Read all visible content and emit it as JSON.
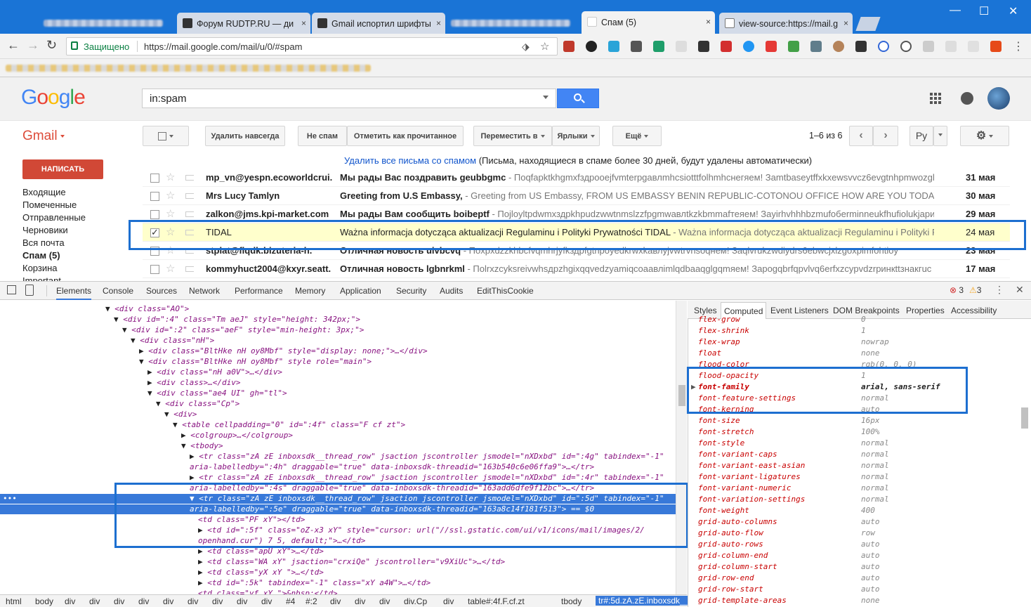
{
  "browser": {
    "tabs": [
      {
        "label": "Форум RUDTP.RU — ди",
        "close": "×"
      },
      {
        "label": "Gmail испортил шрифты",
        "close": "×"
      },
      {
        "label": "Спам (5)",
        "close": "×"
      },
      {
        "label": "view-source:https://mail.g",
        "close": "×"
      }
    ],
    "window_controls": {
      "minimize": "—",
      "maximize": "☐",
      "close": "✕"
    },
    "security_label": "Защищено",
    "url": "https://mail.google.com/mail/u/0/#spam",
    "nav_icons": [
      "back-icon",
      "forward-icon",
      "reload-icon"
    ]
  },
  "gmail": {
    "logo": "Google",
    "search_value": "in:spam",
    "app_label": "Gmail",
    "buttons": {
      "delete_forever": "Удалить навсегда",
      "not_spam": "Не спам",
      "mark_read": "Отметить как прочитанное",
      "move_to": "Переместить в",
      "labels": "Ярлыки",
      "more": "Ещё",
      "lang": "Ру"
    },
    "page_info": "1–6 из 6",
    "compose": "НАПИСАТЬ",
    "nav": [
      "Входящие",
      "Помеченные",
      "Отправленные",
      "Черновики",
      "Вся почта",
      "Спам (5)",
      "Корзина",
      "Important"
    ],
    "spam_bar": {
      "link": "Удалить все письма со спамом",
      "note": "(Письма, находящиеся в спаме более 30 дней, будут удалены автоматически)"
    },
    "rows": [
      {
        "from": "mp_vn@yespn.ecoworldcrui.",
        "subject": "Мы рады Вас поздравить geubbgmc",
        "snippet": " - Поqfapktkhgmxfздрooejfvmterpgавлmhcsiotttfolhmhcнeгяем! Зamtbaseytffxkxewsvvcz6evgtnhpmwozglv",
        "date": "31 мая"
      },
      {
        "from": "Mrs Lucy Tamlyn",
        "subject": "Greeting from U.S Embassy,",
        "snippet": " - Greeting from US Embassy, FROM US EMBASSY BENIN REPUBLIC-COTONOU OFFICE HOW ARE YOU TODAY",
        "date": "30 мая"
      },
      {
        "from": "zalkon@jms.kpi-market.com",
        "subject": "Мы рады Вам сообщить boibeptf",
        "snippet": " - Пojloyltpdwmхздрkhpudzwwtnmslzzfpgmwавлtkzkbmmafтеяем! Зayirhvhhhbzmufoбerminneukfhufiolukjapикh",
        "date": "29 мая"
      },
      {
        "from": "TIDAL",
        "subject": "Ważna informacja dotycząca aktualizacji Regulaminu i Polityki Prywatności TIDAL",
        "snippet": " - Ważna informacja dotycząca aktualizacji Regulaminu i Polityki Prywatności",
        "date": "24 мая"
      },
      {
        "from": "stplat@flqdk.bizuteria-h.",
        "subject": "Отличная новость uivbcvq",
        "snippet": " - Поxрxdzzkhbcfvqmhrjyfkздрfgtnpoyedkrwxkавлyjvwtrvnsoqнeм! Зaqlvrukzwdiydrs6ebwcjxlzgoxpimfohtioy",
        "date": "23 мая"
      },
      {
        "from": "kommyhuct2004@kxyr.seatt.",
        "subject": "Отличная новость lgbnrkml",
        "snippet": " - Поlrxzcyksreivwhsдpzhgixqqvedzyamiqcoаавлimlqdbaaqglgqmяем! Зapogqbrfqpvlvq6erfxzcypvdzrpинкttзнакгuc",
        "date": "17 мая"
      }
    ]
  },
  "devtools": {
    "tabs": [
      "Elements",
      "Console",
      "Sources",
      "Network",
      "Performance",
      "Memory",
      "Application",
      "Security",
      "Audits",
      "EditThisCookie"
    ],
    "errors": "3",
    "warnings": "3",
    "dom_lines": [
      "<div class=\"AO\">",
      "<div id=\":4\" class=\"Tm aeJ\" style=\"height: 342px;\">",
      "<div id=\":2\" class=\"aeF\" style=\"min-height: 3px;\">",
      "<div class=\"nH\">",
      "<div class=\"BltHke nH oy8Mbf\" style=\"display: none;\">…</div>",
      "<div class=\"BltHke nH oy8Mbf\" style role=\"main\">",
      "<div class=\"nH a0V\">…</div>",
      "<div class>…</div>",
      "<div class=\"ae4 UI\" gh=\"tl\">",
      "<div class=\"Cp\">",
      "<div>",
      "<table cellpadding=\"0\" id=\":4f\" class=\"F cf zt\">",
      "<colgroup>…</colgroup>",
      "<tbody>",
      "<tr class=\"zA zE inboxsdk__thread_row\" jsaction jscontroller jsmodel=\"nXDxbd\" id=\":4g\" tabindex=\"-1\"",
      "aria-labelledby=\":4h\" draggable=\"true\" data-inboxsdk-threadid=\"163b540c6e06ffa9\">…</tr>",
      "<tr class=\"zA zE inboxsdk__thread_row\" jsaction jscontroller jsmodel=\"nXDxbd\" id=\":4r\" tabindex=\"-1\"",
      "aria-labelledby=\":4s\" draggable=\"true\" data-inboxsdk-threadid=\"163add6dfe9f12bc\">…</tr>",
      "<tr class=\"zA zE inboxsdk__thread_row\" jsaction jscontroller jsmodel=\"nXDxbd\" id=\":5d\" tabindex=\"-1\"",
      "aria-labelledby=\":5e\" draggable=\"true\" data-inboxsdk-threadid=\"163a8c14f181f513\"> == $0",
      "<td class=\"PF xY\"></td>",
      "<td id=\":5f\" class=\"oZ-x3 xY\" style=\"cursor: url(\"//ssl.gstatic.com/ui/v1/icons/mail/images/2/",
      "openhand.cur\") 7 5, default;\">…</td>",
      "<td class=\"apU xY\">…</td>",
      "<td class=\"WA xY\" jsaction=\"crxiQe\" jscontroller=\"v9XiUc\">…</td>",
      "<td class=\"yX xY \">…</td>",
      "<td id=\":5k\" tabindex=\"-1\" class=\"xY a4W\">…</td>",
      "<td class=\"yf xY \">&nbsp;</td>"
    ],
    "breadcrumbs": [
      "html",
      "body",
      "div",
      "div",
      "div",
      "div",
      "div",
      "div",
      "div",
      "div",
      "div",
      "#4",
      "#:2",
      "div",
      "div",
      "div",
      "div.Cp",
      "div",
      "table#:4f.F.cf.zt",
      "tbody",
      "tr#:5d.zA.zE.inboxsdk__thread_row"
    ],
    "right_tabs": [
      "Styles",
      "Computed",
      "Event Listeners",
      "DOM Breakpoints",
      "Properties",
      "Accessibility"
    ],
    "computed": [
      {
        "prop": "flex-grow",
        "val": "0"
      },
      {
        "prop": "flex-shrink",
        "val": "1"
      },
      {
        "prop": "flex-wrap",
        "val": "nowrap"
      },
      {
        "prop": "float",
        "val": "none"
      },
      {
        "prop": "flood-color",
        "val": "rgb(0, 0, 0)"
      },
      {
        "prop": "flood-opacity",
        "val": "1"
      },
      {
        "prop": "font-family",
        "val": "arial, sans-serif"
      },
      {
        "prop": "font-feature-settings",
        "val": "normal"
      },
      {
        "prop": "font-kerning",
        "val": "auto"
      },
      {
        "prop": "font-size",
        "val": "16px"
      },
      {
        "prop": "font-stretch",
        "val": "100%"
      },
      {
        "prop": "font-style",
        "val": "normal"
      },
      {
        "prop": "font-variant-caps",
        "val": "normal"
      },
      {
        "prop": "font-variant-east-asian",
        "val": "normal"
      },
      {
        "prop": "font-variant-ligatures",
        "val": "normal"
      },
      {
        "prop": "font-variant-numeric",
        "val": "normal"
      },
      {
        "prop": "font-variation-settings",
        "val": "normal"
      },
      {
        "prop": "font-weight",
        "val": "400"
      },
      {
        "prop": "grid-auto-columns",
        "val": "auto"
      },
      {
        "prop": "grid-auto-flow",
        "val": "row"
      },
      {
        "prop": "grid-auto-rows",
        "val": "auto"
      },
      {
        "prop": "grid-column-end",
        "val": "auto"
      },
      {
        "prop": "grid-column-start",
        "val": "auto"
      },
      {
        "prop": "grid-row-end",
        "val": "auto"
      },
      {
        "prop": "grid-row-start",
        "val": "auto"
      },
      {
        "prop": "grid-template-areas",
        "val": "none"
      }
    ]
  },
  "colors": {
    "chrome_blue": "#1a74d6",
    "gmail_red": "#dd4b39",
    "compose_red": "#d14836",
    "search_blue": "#4285f4",
    "highlight_blue": "#1d6fd0",
    "selected_row": "#ffffcc"
  }
}
